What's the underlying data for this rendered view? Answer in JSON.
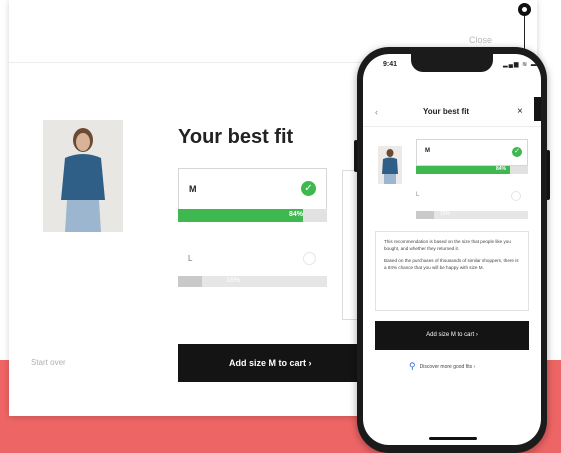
{
  "card": {
    "close_label": "Close",
    "title": "Your best fit",
    "sizes": [
      {
        "label": "M",
        "percent_text": "84%",
        "fill": 0.84,
        "selected": true
      },
      {
        "label": "L",
        "percent_text": "16%",
        "fill": 0.16,
        "selected": false
      }
    ],
    "start_over": "Start over",
    "add_to_cart": "Add size M to cart  ›"
  },
  "phone": {
    "time": "9:41",
    "status_icons": "▂▄▆ ≋ ▬",
    "back": "‹",
    "title": "Your best fit",
    "close": "×",
    "sizes": [
      {
        "label": "M",
        "percent_text": "84%",
        "fill": 0.84
      },
      {
        "label": "L",
        "percent_text": "16%",
        "fill": 0.16
      }
    ],
    "info_para1": "This recommendation is based on the size that people like you bought, and whether they returned it.",
    "info_para2": "Based on the purchases of thousands of similar shoppers, there is a 84% chance that you will be happy with size M.",
    "add_to_cart": "Add size M to cart  ›",
    "discover": "Discover more good fits ›"
  },
  "colors": {
    "accent_green": "#3fb84f",
    "coral_band": "#ee6565",
    "button_dark": "#141414"
  },
  "icons": {
    "check": "✓",
    "search": "⚲"
  }
}
